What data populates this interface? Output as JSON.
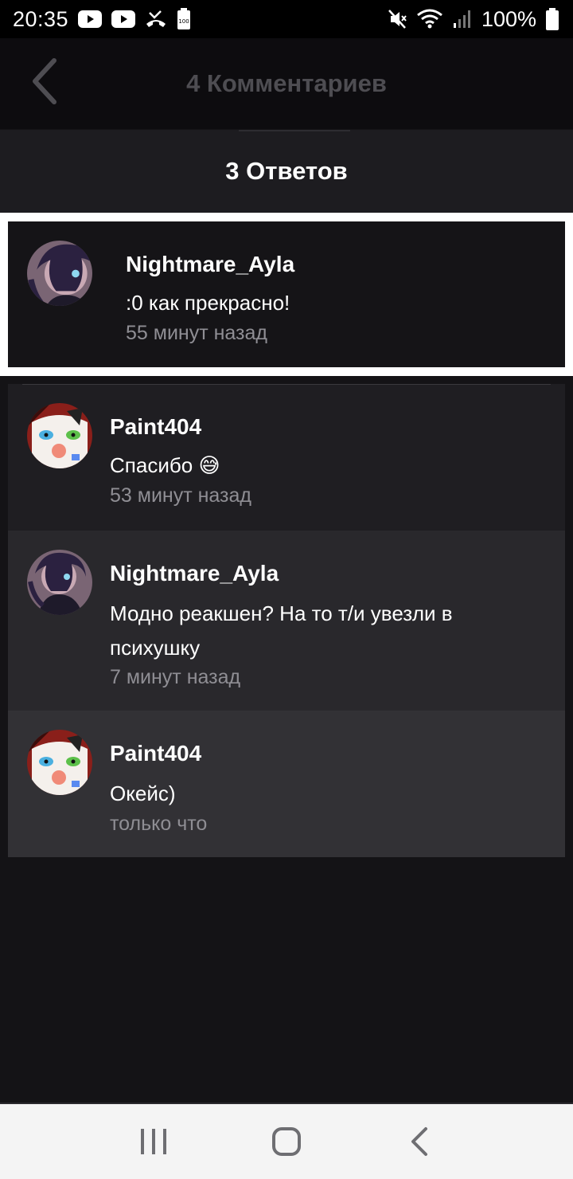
{
  "status_bar": {
    "time": "20:35",
    "battery_percent": "100%",
    "icons_left": [
      "youtube-icon",
      "youtube-icon",
      "missed-call-icon",
      "battery-saver-icon"
    ],
    "icons_right": [
      "mute-icon",
      "wifi-icon",
      "signal-icon",
      "battery-icon"
    ]
  },
  "header": {
    "title": "4 Комментариев",
    "back_icon": "chevron-left-icon"
  },
  "replies_bar": {
    "title": "3 Ответов"
  },
  "main_comment": {
    "author": "Nightmare_Ayla",
    "text": ":0 как прекрасно!",
    "time": "55 минут назад"
  },
  "replies": [
    {
      "author": "Paint404",
      "text": "Спасибо",
      "emoji": "😅",
      "time": "53 минут назад"
    },
    {
      "author": "Nightmare_Ayla",
      "text_line1": "Модно реакшен? На то т/и увезли в",
      "text_line2": "психушку",
      "time": "7 минут назад"
    },
    {
      "author": "Paint404",
      "text": "Окейс)",
      "time": "только что"
    }
  ],
  "colors": {
    "background": "#141316",
    "header": "#0d0c0f",
    "muted_title": "#4e4d52",
    "timestamp": "#8f8e94"
  }
}
